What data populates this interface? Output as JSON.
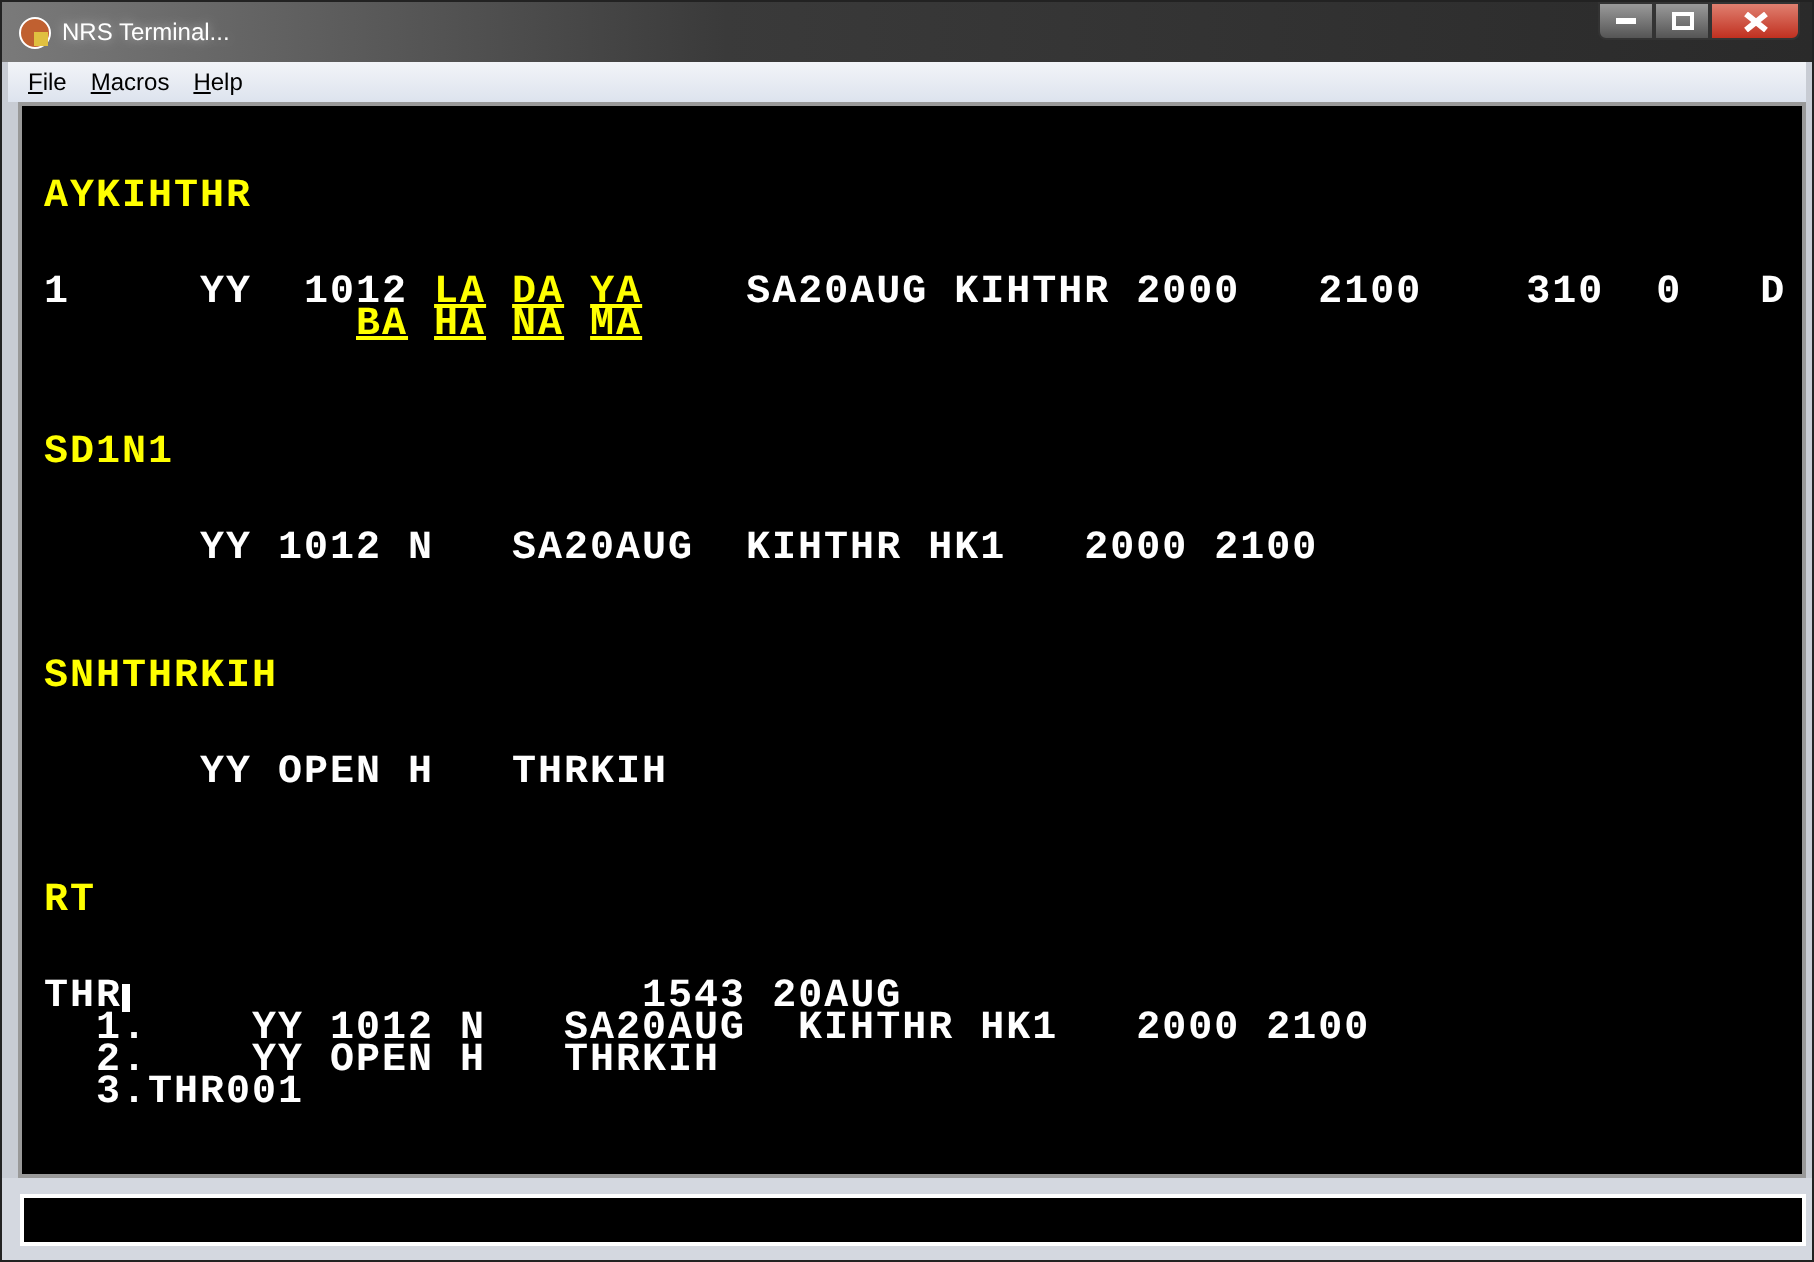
{
  "window": {
    "title": "NRS Terminal..."
  },
  "menu": [
    {
      "label": "File"
    },
    {
      "label": "Macros"
    },
    {
      "label": "Help"
    }
  ],
  "screen": [
    {
      "kind": "heading",
      "segments": [
        {
          "text": "AYKIHTHR"
        }
      ]
    },
    {
      "kind": "text",
      "segments": [
        {
          "text": "1     YY  1012"
        },
        {
          "text": "LA",
          "kind": "link"
        },
        {
          "text": "DA",
          "kind": "link"
        },
        {
          "text": "YA",
          "kind": "link"
        },
        {
          "text": "   SA20AUG KIHTHR 2000   2100    310  0   D"
        }
      ]
    },
    {
      "kind": "continuation",
      "segments": [
        {
          "text": "BA",
          "kind": "link"
        },
        {
          "text": "HA",
          "kind": "link"
        },
        {
          "text": "NA",
          "kind": "link"
        },
        {
          "text": "MA",
          "kind": "link"
        }
      ]
    },
    {
      "kind": "heading",
      "segments": [
        {
          "text": "SD1N1"
        }
      ]
    },
    {
      "kind": "text",
      "segments": [
        {
          "text": "      YY 1012 N   SA20AUG  KIHTHR HK1   2000 2100"
        }
      ]
    },
    {
      "kind": "heading",
      "segments": [
        {
          "text": "SNHTHRKIH"
        }
      ]
    },
    {
      "kind": "text",
      "segments": [
        {
          "text": "      YY OPEN H   THRKIH"
        }
      ]
    },
    {
      "kind": "heading",
      "segments": [
        {
          "text": "RT"
        }
      ]
    },
    {
      "kind": "text",
      "segments": [
        {
          "text": "THR"
        },
        {
          "kind": "cursor"
        },
        {
          "text": "                   1543 20AUG"
        }
      ]
    },
    {
      "kind": "text",
      "segments": [
        {
          "text": "  1.    YY 1012 N   SA20AUG  KIHTHR HK1   2000 2100"
        }
      ]
    },
    {
      "kind": "text",
      "segments": [
        {
          "text": "  2.    YY OPEN H   THRKIH"
        }
      ]
    },
    {
      "kind": "text",
      "segments": [
        {
          "text": "  3.THR001"
        }
      ]
    }
  ]
}
